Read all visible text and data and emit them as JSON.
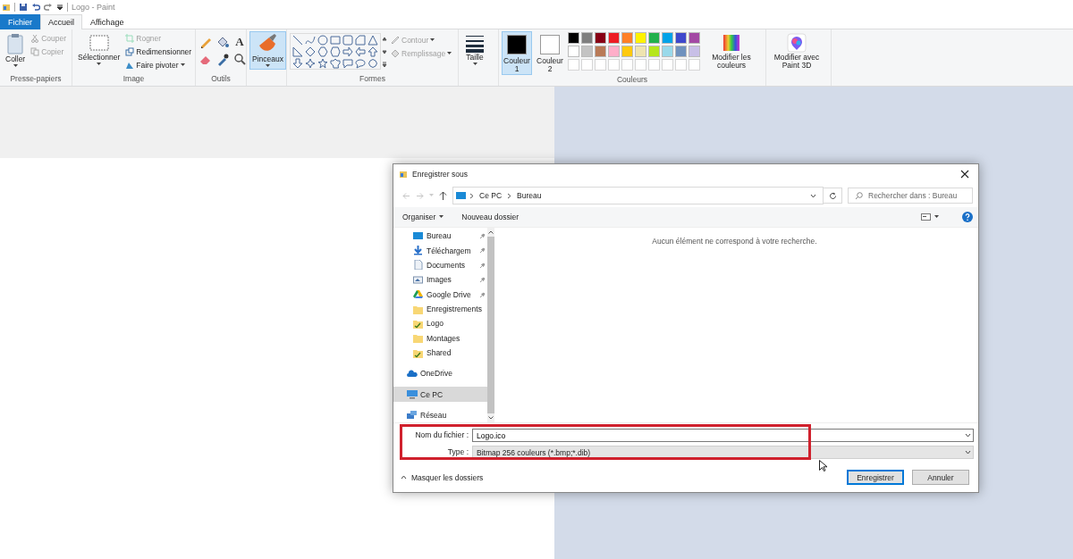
{
  "app": {
    "title": "Logo - Paint"
  },
  "tabs": [
    {
      "label": "Fichier",
      "kind": "file",
      "selected": false
    },
    {
      "label": "Accueil",
      "kind": "tab",
      "selected": true
    },
    {
      "label": "Affichage",
      "kind": "tab",
      "selected": false
    }
  ],
  "ribbon": {
    "clipboard": {
      "label": "Presse-papiers",
      "paste": "Coller",
      "cut": {
        "label": "Couper",
        "disabled": true
      },
      "copy": {
        "label": "Copier",
        "disabled": true
      }
    },
    "image": {
      "label": "Image",
      "select": "Sélectionner",
      "crop": {
        "label": "Rogner",
        "disabled": true
      },
      "resize": {
        "label": "Redimensionner",
        "disabled": false
      },
      "rotate": {
        "label": "Faire pivoter",
        "disabled": false
      }
    },
    "tools": {
      "label": "Outils",
      "items": [
        {
          "kind": "pencil"
        },
        {
          "kind": "fill"
        },
        {
          "kind": "text",
          "glyph": "A"
        },
        {
          "kind": "eraser"
        },
        {
          "kind": "picker"
        },
        {
          "kind": "magnifier"
        }
      ]
    },
    "brushes": {
      "label": "Pinceaux",
      "selected": true
    },
    "shapes": {
      "label": "Formes",
      "outline": {
        "label": "Contour",
        "disabled": true
      },
      "fill": {
        "label": "Remplissage",
        "disabled": true
      }
    },
    "size": {
      "label": "Taille"
    },
    "colors": {
      "label": "Couleurs",
      "color1": {
        "label": "Couleur 1",
        "color": "#000000",
        "selected": true
      },
      "color2": {
        "label": "Couleur 2",
        "color": "#ffffff",
        "selected": false
      },
      "palette": [
        {
          "color": "#000000"
        },
        {
          "color": "#7f7f7f"
        },
        {
          "color": "#880015"
        },
        {
          "color": "#ed1c24"
        },
        {
          "color": "#ff7f27"
        },
        {
          "color": "#fff200"
        },
        {
          "color": "#22b14c"
        },
        {
          "color": "#00a2e8"
        },
        {
          "color": "#3f48cc"
        },
        {
          "color": "#a349a4"
        },
        {
          "color": "#ffffff"
        },
        {
          "color": "#c3c3c3"
        },
        {
          "color": "#b97a57"
        },
        {
          "color": "#ffaec9"
        },
        {
          "color": "#ffc90e"
        },
        {
          "color": "#efe4b0"
        },
        {
          "color": "#b5e61d"
        },
        {
          "color": "#99d9ea"
        },
        {
          "color": "#7092be"
        },
        {
          "color": "#c8bfe7"
        }
      ],
      "edit_colors": "Modifier les couleurs"
    },
    "paint3d": "Modifier avec Paint 3D"
  },
  "dialog": {
    "title": "Enregistrer sous",
    "path": [
      "Ce PC",
      "Bureau"
    ],
    "search": {
      "placeholder": "Rechercher dans : Bureau"
    },
    "toolbar": {
      "organize": "Organiser",
      "new_folder": "Nouveau dossier"
    },
    "quick_access": [
      {
        "label": "Bureau",
        "kind": "desktop",
        "pinned": true,
        "selected": false
      },
      {
        "label": "Téléchargem",
        "kind": "download",
        "pinned": true,
        "selected": false
      },
      {
        "label": "Documents",
        "kind": "document",
        "pinned": true,
        "selected": false
      },
      {
        "label": "Images",
        "kind": "pictures",
        "pinned": true,
        "selected": false
      },
      {
        "label": "Google Drive",
        "kind": "drive",
        "pinned": true,
        "selected": false
      },
      {
        "label": "Enregistrements",
        "kind": "folder",
        "pinned": false,
        "selected": false
      },
      {
        "label": "Logo",
        "kind": "folder-check",
        "pinned": false,
        "selected": false
      },
      {
        "label": "Montages",
        "kind": "folder",
        "pinned": false,
        "selected": false
      },
      {
        "label": "Shared",
        "kind": "folder-check",
        "pinned": false,
        "selected": false
      }
    ],
    "locations": [
      {
        "label": "OneDrive",
        "kind": "cloud",
        "selected": false
      },
      {
        "label": "Ce PC",
        "kind": "pc",
        "selected": true
      },
      {
        "label": "Réseau",
        "kind": "network",
        "selected": false
      }
    ],
    "empty_message": "Aucun élément ne correspond à votre recherche.",
    "file_name": {
      "label": "Nom du fichier :",
      "value": "Logo.ico"
    },
    "file_type": {
      "label": "Type :",
      "value": "Bitmap 256 couleurs (*.bmp;*.dib)"
    },
    "hide_folders": "Masquer les dossiers",
    "buttons": [
      {
        "label": "Enregistrer",
        "default": true
      },
      {
        "label": "Annuler",
        "default": false
      }
    ]
  }
}
